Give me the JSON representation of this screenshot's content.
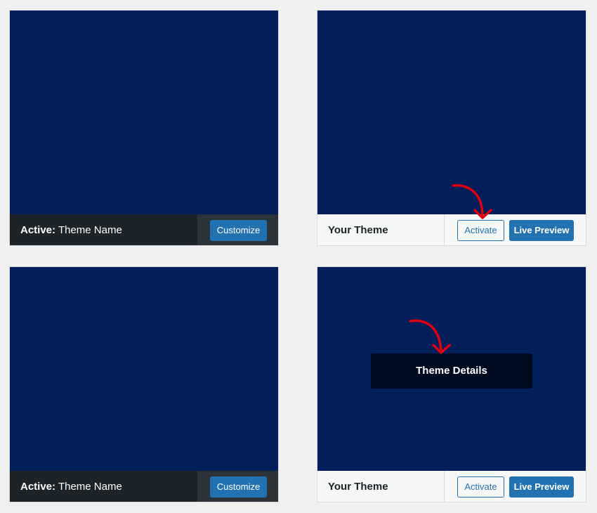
{
  "themes": [
    {
      "status": "active",
      "active_label": "Active:",
      "name": "Theme Name",
      "customize_label": "Customize"
    },
    {
      "status": "inactive",
      "name": "Your Theme",
      "activate_label": "Activate",
      "preview_label": "Live Preview"
    },
    {
      "status": "active",
      "active_label": "Active:",
      "name": "Theme Name",
      "customize_label": "Customize"
    },
    {
      "status": "inactive",
      "name": "Your Theme",
      "activate_label": "Activate",
      "preview_label": "Live Preview",
      "details_label": "Theme Details"
    }
  ],
  "colors": {
    "page_background": "#f0f0f1",
    "screenshot_background": "#021f5c",
    "active_bar": "#1d2327",
    "primary_button": "#2271b1",
    "annotation_arrow": "#e0000e"
  },
  "icons": {
    "annotation": "curved-arrow-icon"
  }
}
